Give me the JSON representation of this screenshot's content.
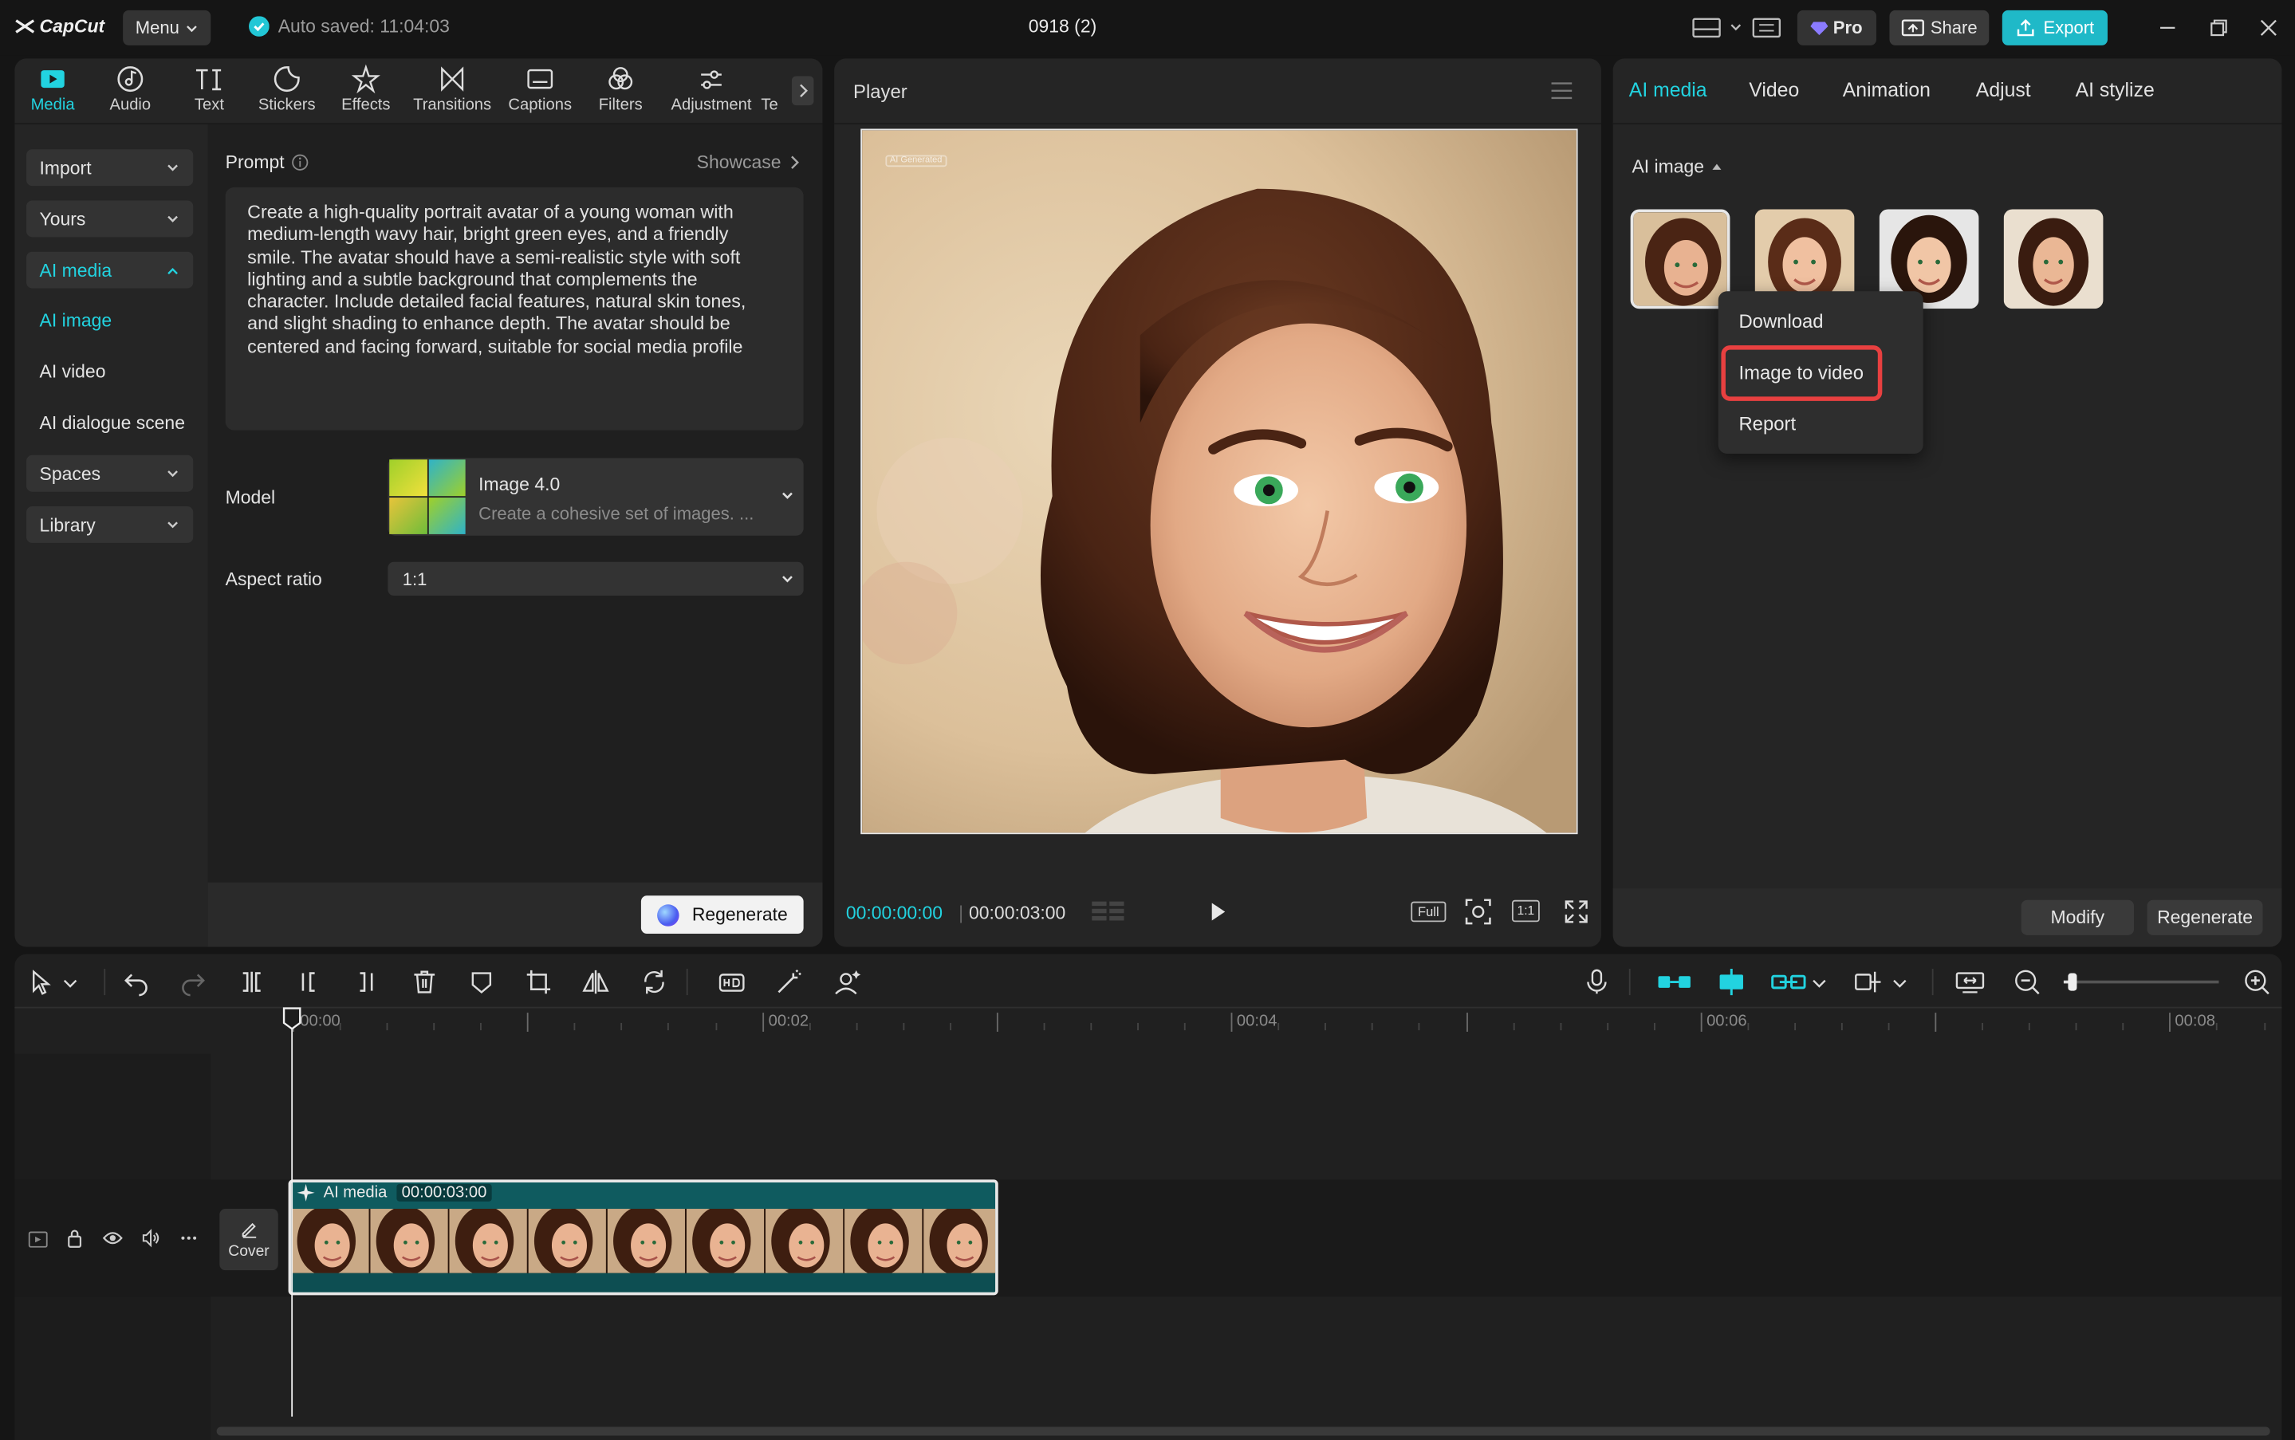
{
  "app": {
    "logo": "CapCut",
    "menu_label": "Menu",
    "autosave": "Auto saved: 11:04:03",
    "project_title": "0918 (2)",
    "pro_label": "Pro",
    "share_label": "Share",
    "export_label": "Export",
    "accent": "#22d3e0"
  },
  "toolbar": {
    "tabs": [
      {
        "label": "Media",
        "icon": "media-icon"
      },
      {
        "label": "Audio",
        "icon": "audio-icon"
      },
      {
        "label": "Text",
        "icon": "text-icon"
      },
      {
        "label": "Stickers",
        "icon": "stickers-icon"
      },
      {
        "label": "Effects",
        "icon": "effects-icon"
      },
      {
        "label": "Transitions",
        "icon": "transitions-icon"
      },
      {
        "label": "Captions",
        "icon": "captions-icon"
      },
      {
        "label": "Filters",
        "icon": "filters-icon"
      },
      {
        "label": "Adjustment",
        "icon": "adjustment-icon"
      },
      {
        "label": "Te",
        "icon": "template-icon"
      }
    ],
    "active": "Media"
  },
  "sidebar": {
    "import": "Import",
    "yours": "Yours",
    "ai_media": "AI media",
    "ai_image": "AI image",
    "ai_video": "AI video",
    "ai_dialogue": "AI dialogue scene",
    "spaces": "Spaces",
    "library": "Library"
  },
  "prompt_panel": {
    "prompt_label": "Prompt",
    "showcase": "Showcase",
    "prompt_text": "Create a high-quality portrait avatar of a young woman with medium-length wavy hair, bright green eyes, and a friendly smile. The avatar should have a semi-realistic style with soft lighting and a subtle background that complements the character. Include detailed facial features, natural skin tones, and slight shading to enhance depth. The avatar should be centered and facing forward, suitable for social media profile",
    "model_label": "Model",
    "model_name": "Image 4.0",
    "model_desc": "Create a cohesive set of images. ...",
    "aspect_label": "Aspect ratio",
    "aspect_value": "1:1",
    "regenerate": "Regenerate"
  },
  "player": {
    "title": "Player",
    "watermark": "AI Generated",
    "current_time": "00:00:00:00",
    "total_time": "00:00:03:00",
    "full_label": "Full",
    "ratio_label": "1:1"
  },
  "right_panel": {
    "tabs": [
      "AI media",
      "Video",
      "Animation",
      "Adjust",
      "AI stylize"
    ],
    "active_tab": "AI media",
    "section": "AI image",
    "context_menu": [
      "Download",
      "Image to video",
      "Report"
    ],
    "highlighted_item": "Image to video",
    "modify": "Modify",
    "regenerate": "Regenerate"
  },
  "timeline": {
    "ticks": [
      "00:00",
      "00:02",
      "00:04",
      "00:06",
      "00:08"
    ],
    "clip_label": "AI media",
    "clip_duration": "00:00:03:00",
    "cover_label": "Cover",
    "zoom_level": 0.06
  }
}
